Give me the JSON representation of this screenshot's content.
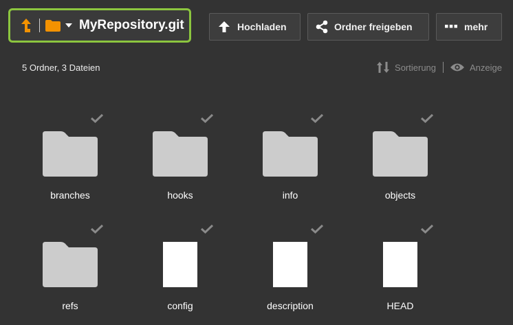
{
  "header": {
    "repository_title": "MyRepository.git",
    "icons": {
      "up": "arrow-up-icon",
      "folder": "folder-icon",
      "caret": "caret-down-icon"
    },
    "accent_color": "#8cc63f",
    "icon_color": "#f39200"
  },
  "actions": {
    "upload_label": "Hochladen",
    "share_label": "Ordner freigeben",
    "more_label": "mehr",
    "icons": {
      "upload": "upload-arrow-icon",
      "share": "share-icon",
      "more": "ellipsis-icon"
    }
  },
  "summary": {
    "count_text": "5 Ordner, 3 Dateien"
  },
  "view_toolbar": {
    "sort_label": "Sortierung",
    "view_label": "Anzeige",
    "icons": {
      "sort": "sort-arrows-icon",
      "view": "eye-icon"
    }
  },
  "items": [
    {
      "name": "branches",
      "type": "folder",
      "icon": "folder-icon"
    },
    {
      "name": "hooks",
      "type": "folder",
      "icon": "folder-icon"
    },
    {
      "name": "info",
      "type": "folder",
      "icon": "folder-icon"
    },
    {
      "name": "objects",
      "type": "folder",
      "icon": "folder-icon"
    },
    {
      "name": "refs",
      "type": "folder",
      "icon": "folder-icon"
    },
    {
      "name": "config",
      "type": "file",
      "icon": "file-icon"
    },
    {
      "name": "description",
      "type": "file",
      "icon": "file-icon"
    },
    {
      "name": "HEAD",
      "type": "file",
      "icon": "file-icon"
    }
  ],
  "colors": {
    "background": "#333333",
    "folder": "#cccccc",
    "file": "#ffffff",
    "check": "#8a8a8a"
  }
}
